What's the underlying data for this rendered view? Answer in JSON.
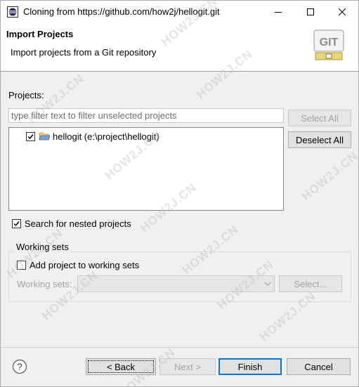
{
  "window": {
    "title": "Cloning from https://github.com/how2j/hellogit.git"
  },
  "banner": {
    "title": "Import Projects",
    "description": "Import projects from a Git repository",
    "logo_text": "GIT"
  },
  "projects": {
    "label": "Projects:",
    "filter_placeholder": "type filter text to filter unselected projects",
    "select_all": "Select All",
    "deselect_all": "Deselect All",
    "items": [
      {
        "label": "hellogit (e:\\project\\hellogit)",
        "checked": true
      }
    ]
  },
  "options": {
    "search_nested": "Search for nested projects",
    "search_nested_checked": true
  },
  "working_sets": {
    "group_label": "Working sets",
    "add_label": "Add project to working sets",
    "add_checked": false,
    "sets_label": "Working sets:",
    "select_button": "Select..."
  },
  "footer": {
    "back": "< Back",
    "next": "Next >",
    "finish": "Finish",
    "cancel": "Cancel"
  },
  "watermark": "HOW2J.CN"
}
